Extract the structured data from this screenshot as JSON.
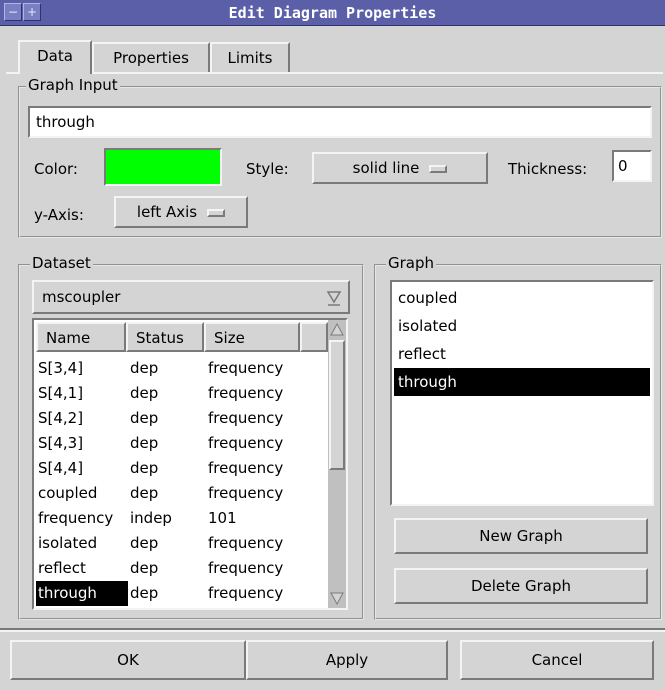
{
  "window": {
    "title": "Edit Diagram Properties"
  },
  "tabs": [
    {
      "label": "Data",
      "active": true
    },
    {
      "label": "Properties",
      "active": false
    },
    {
      "label": "Limits",
      "active": false
    }
  ],
  "graph_input": {
    "legend": "Graph Input",
    "value": "through",
    "color_label": "Color:",
    "color": "#00ff00",
    "style_label": "Style:",
    "style_value": "solid line",
    "thickness_label": "Thickness:",
    "thickness_value": "0",
    "yaxis_label": "y-Axis:",
    "yaxis_value": "left Axis"
  },
  "dataset": {
    "legend": "Dataset",
    "selected": "mscoupler",
    "columns": [
      "Name",
      "Status",
      "Size"
    ],
    "rows": [
      {
        "name": "S[3,4]",
        "status": "dep",
        "size": "frequency"
      },
      {
        "name": "S[4,1]",
        "status": "dep",
        "size": "frequency"
      },
      {
        "name": "S[4,2]",
        "status": "dep",
        "size": "frequency"
      },
      {
        "name": "S[4,3]",
        "status": "dep",
        "size": "frequency"
      },
      {
        "name": "S[4,4]",
        "status": "dep",
        "size": "frequency"
      },
      {
        "name": "coupled",
        "status": "dep",
        "size": "frequency"
      },
      {
        "name": "frequency",
        "status": "indep",
        "size": "101"
      },
      {
        "name": "isolated",
        "status": "dep",
        "size": "frequency"
      },
      {
        "name": "reflect",
        "status": "dep",
        "size": "frequency"
      },
      {
        "name": "through",
        "status": "dep",
        "size": "frequency",
        "selected": true
      }
    ]
  },
  "graph": {
    "legend": "Graph",
    "items": [
      {
        "label": "coupled"
      },
      {
        "label": "isolated"
      },
      {
        "label": "reflect"
      },
      {
        "label": "through",
        "selected": true
      }
    ],
    "new_label": "New Graph",
    "delete_label": "Delete Graph"
  },
  "footer": {
    "ok_label": "OK",
    "apply_label": "Apply",
    "cancel_label": "Cancel"
  }
}
